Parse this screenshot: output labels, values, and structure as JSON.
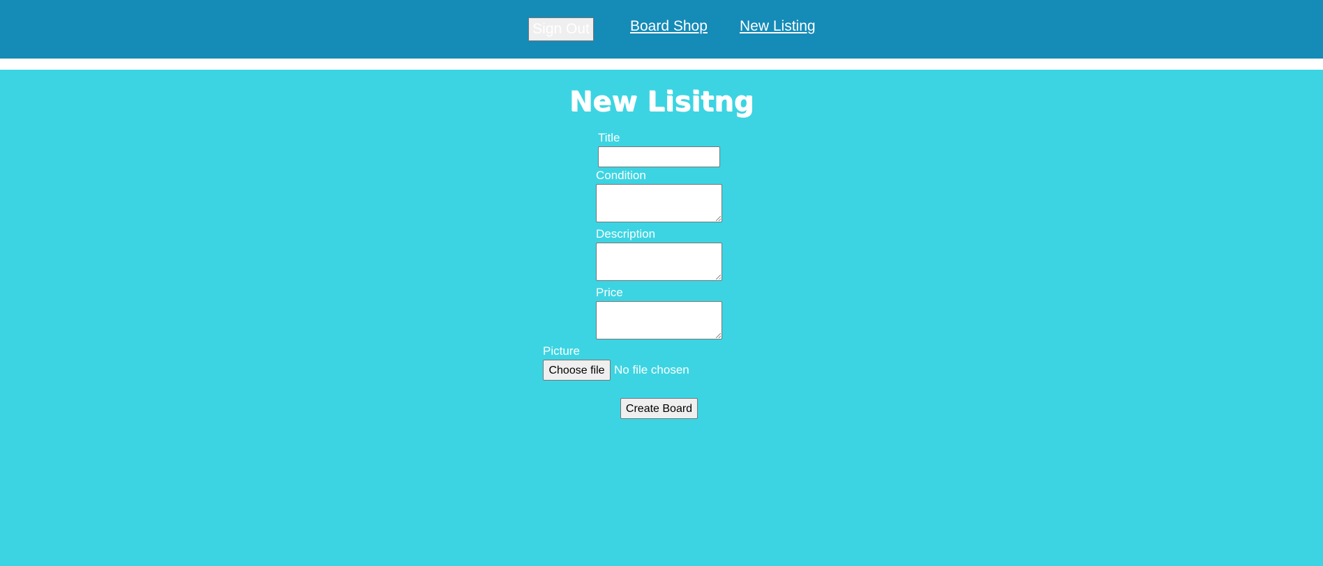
{
  "nav": {
    "sign_out_label": "Sign Out",
    "links": [
      "Board Shop",
      "New Listing"
    ]
  },
  "page": {
    "title": "New Lisitng"
  },
  "form": {
    "title_label": "Title",
    "title_value": "",
    "condition_label": "Condition",
    "condition_value": "",
    "description_label": "Description",
    "description_value": "",
    "price_label": "Price",
    "price_value": "",
    "picture_label": "Picture",
    "choose_file_label": "Choose file",
    "file_status": "No file chosen",
    "submit_label": "Create Board"
  },
  "colors": {
    "navbar": "#158bb7",
    "main_background": "#3cd4e2",
    "text": "#ffffff"
  }
}
